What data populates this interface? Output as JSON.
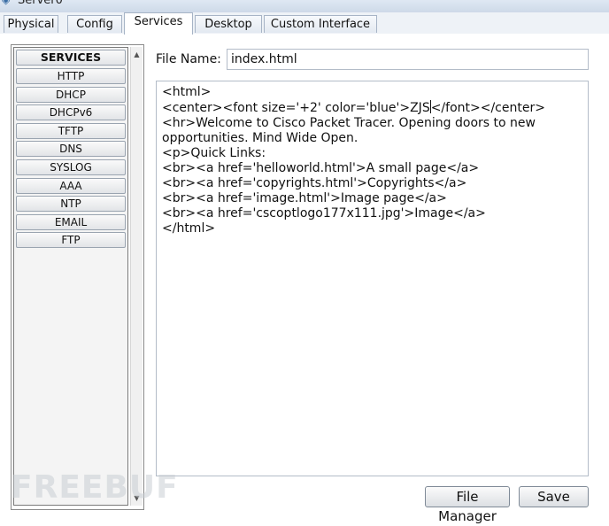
{
  "window": {
    "title": "Server0",
    "icon": "server-icon"
  },
  "tabs": [
    {
      "label": "Physical"
    },
    {
      "label": "Config"
    },
    {
      "label": "Services",
      "active": true
    },
    {
      "label": "Desktop"
    },
    {
      "label": "Custom Interface"
    }
  ],
  "services": {
    "header": "SERVICES",
    "items": [
      "HTTP",
      "DHCP",
      "DHCPv6",
      "TFTP",
      "DNS",
      "SYSLOG",
      "AAA",
      "NTP",
      "EMAIL",
      "FTP"
    ]
  },
  "http": {
    "file_name_label": "File Name:",
    "file_name_value": "index.html",
    "editor_lines": {
      "l1": "<html>",
      "l2a": "<center><font size='+2' color='blue'>ZJS",
      "l2b": "</font></center>",
      "l3": "<hr>Welcome to Cisco Packet Tracer. Opening doors to new",
      "l4": "opportunities. Mind Wide Open.",
      "l5": "<p>Quick Links:",
      "l6": "<br><a href='helloworld.html'>A small page</a>",
      "l7": "<br><a href='copyrights.html'>Copyrights</a>",
      "l8": "<br><a href='image.html'>Image page</a>",
      "l9": "<br><a href='cscoptlogo177x111.jpg'>Image</a>",
      "l10": "</html>"
    },
    "file_manager_label": "File Manager",
    "save_label": "Save"
  },
  "watermark": "FREEBUF"
}
